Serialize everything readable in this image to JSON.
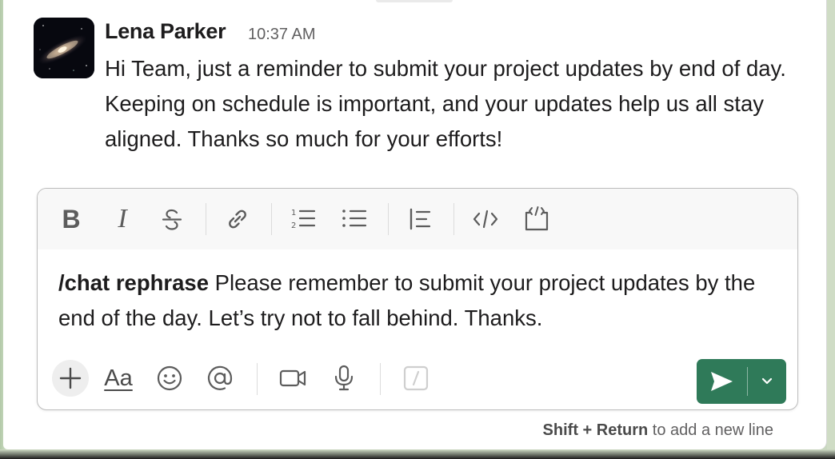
{
  "message": {
    "sender": "Lena Parker",
    "time": "10:37 AM",
    "text": "Hi Team, just a reminder to submit your project updates by end of day. Keeping on schedule is important, and your updates help us all stay aligned. Thanks so much for your efforts!",
    "avatar_icon": "galaxy-avatar"
  },
  "composer": {
    "formatting": [
      "bold-icon",
      "italic-icon",
      "strikethrough-icon",
      "link-icon",
      "numbered-list-icon",
      "bulleted-list-icon",
      "blockquote-icon",
      "code-icon",
      "code-block-icon"
    ],
    "bold_glyph": "B",
    "italic_glyph": "I",
    "input": {
      "command": "/chat rephrase",
      "text": " Please remember to submit your project updates by the end of the day. Let’s try not to fall behind. Thanks."
    },
    "actions": [
      "plus-icon",
      "text-format-icon",
      "emoji-icon",
      "mention-icon",
      "video-icon",
      "microphone-icon",
      "slash-command-icon"
    ],
    "aa_label": "Aa",
    "send_color": "#2f7a59"
  },
  "hint": {
    "keys": "Shift + Return",
    "text": " to add a new line"
  }
}
